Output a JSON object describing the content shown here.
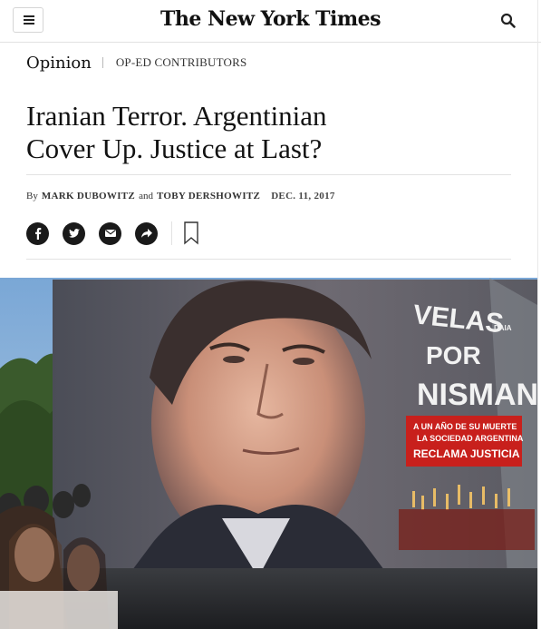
{
  "header": {
    "logo": "The New York Times",
    "menu_icon": "hamburger-icon",
    "search_icon": "search-icon"
  },
  "section": {
    "name": "Opinion",
    "kicker": "OP-ED CONTRIBUTORS"
  },
  "article": {
    "headline_line1": "Iranian Terror. Argentinian",
    "headline_line2": "Cover Up. Justice at Last?",
    "byline_prefix": "By",
    "author1": "MARK DUBOWITZ",
    "byline_and": "and",
    "author2": "TOBY DERSHOWITZ",
    "date": "DEC. 11, 2017"
  },
  "share": {
    "buttons": [
      "facebook-icon",
      "twitter-icon",
      "email-icon",
      "share-icon"
    ],
    "save_icon": "bookmark-icon"
  },
  "hero_image": {
    "banner_line1": "VELAS",
    "banner_line2": "POR",
    "banner_line3": "NISMAN",
    "banner_small": "DAIA",
    "box_line1": "A UN AÑO DE SU MUERTE",
    "box_line2": "LA SOCIEDAD ARGENTINA",
    "box_line3": "RECLAMA JUSTICIA"
  },
  "colors": {
    "text": "#121212",
    "rule": "#e2e2e2",
    "share_button": "#1a1a1a",
    "banner_red": "#c8201c"
  }
}
